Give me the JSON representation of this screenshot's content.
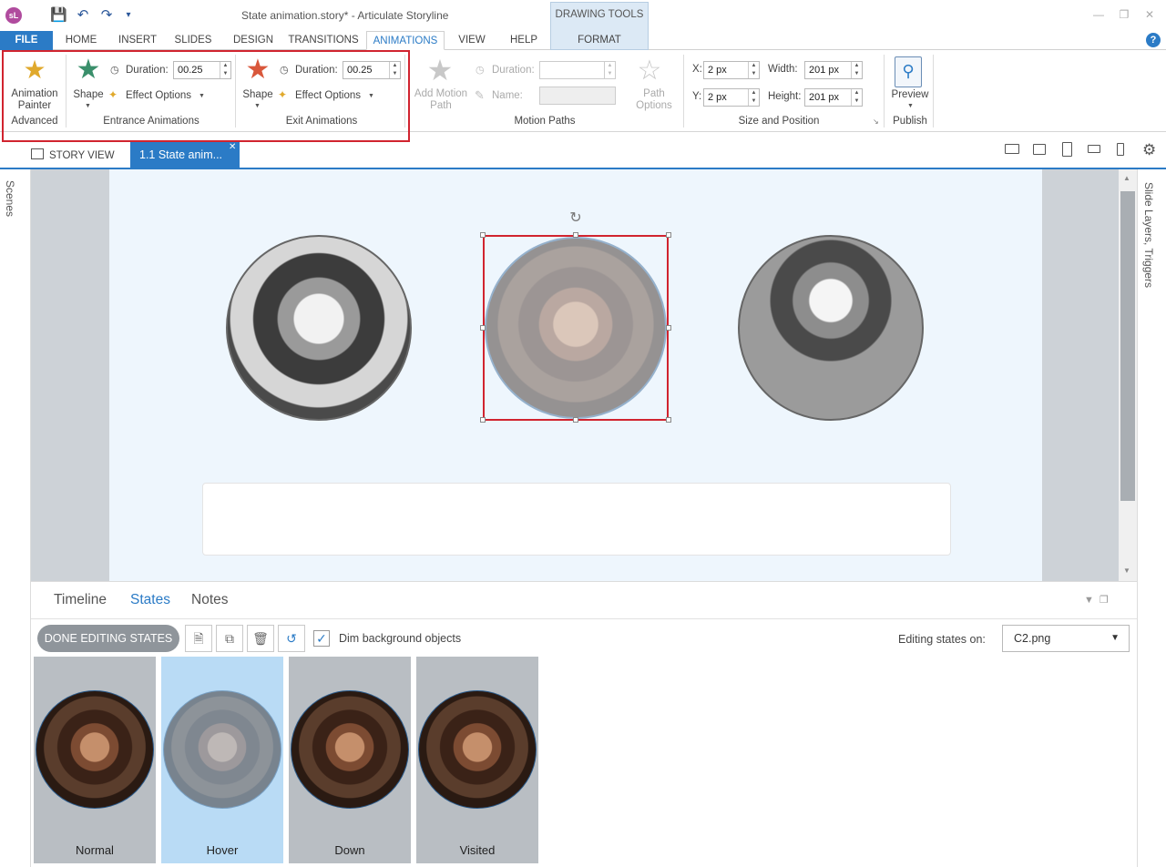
{
  "app": {
    "window_title": "State animation.story* -  Articulate Storyline",
    "app_icon_text": "sL",
    "drawing_tools_label": "DRAWING TOOLS"
  },
  "tabs": [
    "FILE",
    "HOME",
    "INSERT",
    "SLIDES",
    "DESIGN",
    "TRANSITIONS",
    "ANIMATIONS",
    "VIEW",
    "HELP",
    "FORMAT"
  ],
  "ribbon": {
    "animation_painter": "Animation\nPainter",
    "animation_painter_l1": "Animation",
    "animation_painter_l2": "Painter",
    "advanced_group": "Advanced",
    "entrance": {
      "shape_label": "Shape",
      "duration_label": "Duration:",
      "duration_value": "00.25",
      "effect_options": "Effect Options",
      "group_label": "Entrance Animations"
    },
    "exit": {
      "shape_label": "Shape",
      "duration_label": "Duration:",
      "duration_value": "00.25",
      "effect_options": "Effect Options",
      "group_label": "Exit Animations"
    },
    "motion": {
      "add_motion_path_l1": "Add Motion",
      "add_motion_path_l2": "Path",
      "duration_label": "Duration:",
      "name_label": "Name:",
      "path_options_l1": "Path",
      "path_options_l2": "Options",
      "group_label": "Motion Paths"
    },
    "size": {
      "x_label": "X:",
      "x_value": "2 px",
      "y_label": "Y:",
      "y_value": "2 px",
      "width_label": "Width:",
      "width_value": "201 px",
      "height_label": "Height:",
      "height_value": "201 px",
      "group_label": "Size and Position"
    },
    "publish": {
      "preview_label": "Preview",
      "group_label": "Publish"
    }
  },
  "view_tabs": {
    "story_view": "STORY VIEW",
    "slide_tab": "1.1 State anim..."
  },
  "side_panels": {
    "scenes": "Scenes",
    "layers": "Slide Layers, Triggers"
  },
  "bottom": {
    "tabs": [
      "Timeline",
      "States",
      "Notes"
    ],
    "done_button": "DONE EDITING STATES",
    "dim_label": "Dim background objects",
    "dim_checked": true,
    "editing_label": "Editing states on:",
    "editing_value": "C2.png",
    "states": [
      "Normal",
      "Hover",
      "Down",
      "Visited"
    ],
    "selected_state": "Hover"
  },
  "colors": {
    "accent": "#2b7bc6",
    "highlight": "#d1242f"
  }
}
